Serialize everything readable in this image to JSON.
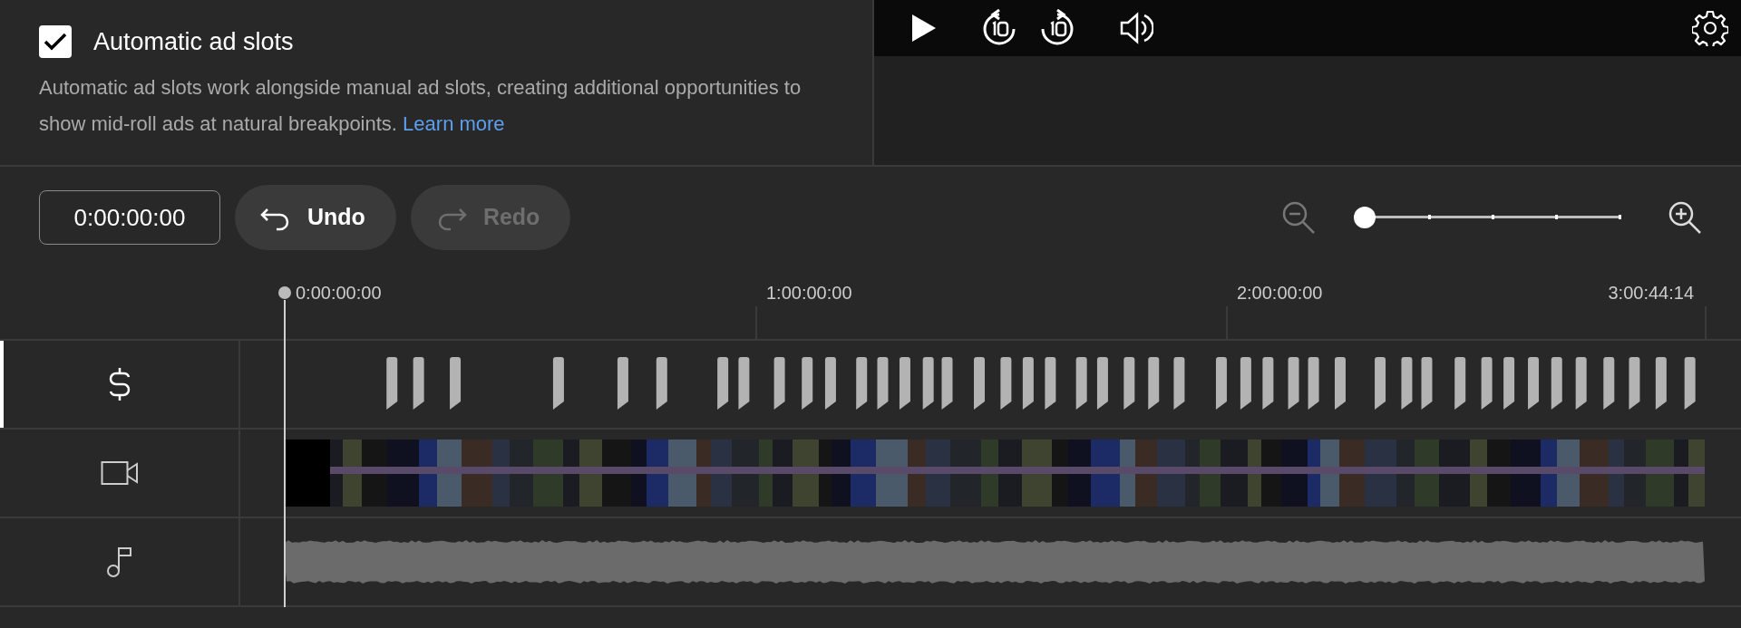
{
  "option": {
    "label": "Automatic ad slots",
    "checked": true,
    "description": "Automatic ad slots work alongside manual ad slots, creating additional opportunities to show mid-roll ads at natural breakpoints.",
    "link": "Learn more"
  },
  "toolbar": {
    "timecode": "0:00:00:00",
    "buttons": [
      {
        "kind": "undo",
        "label": "Undo",
        "disabled": false
      },
      {
        "kind": "redo",
        "label": "Redo",
        "disabled": true
      }
    ],
    "zoom": {
      "level": 0
    }
  },
  "ruler": {
    "labels": [
      "0:00:00:00",
      "1:00:00:00",
      "2:00:00:00",
      "3:00:44:14"
    ]
  },
  "tracks": [
    {
      "kind": "ads",
      "selected": true
    },
    {
      "kind": "video",
      "selected": false
    },
    {
      "kind": "audio",
      "selected": false
    }
  ]
}
